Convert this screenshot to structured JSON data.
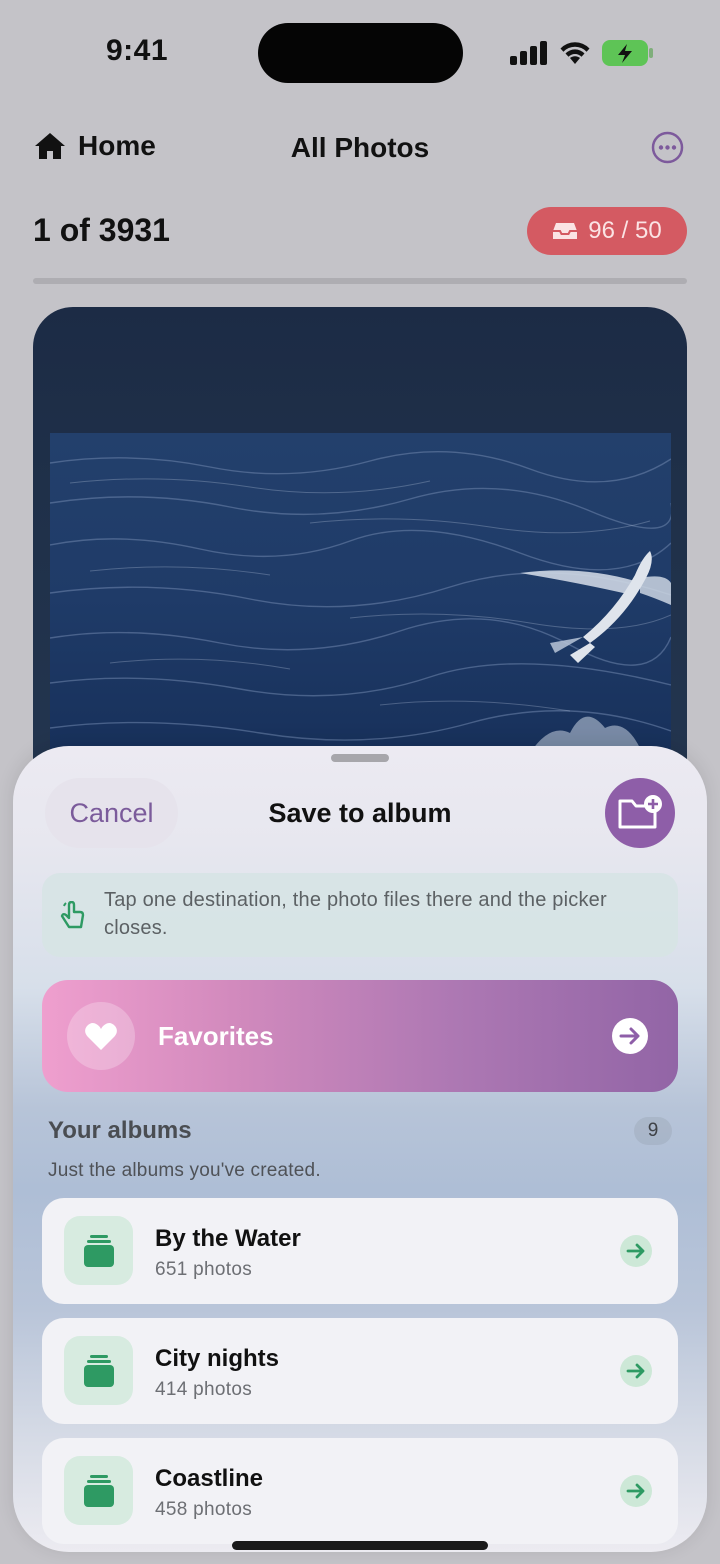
{
  "status_bar": {
    "time": "9:41",
    "icons": [
      "cellular-signal-icon",
      "wifi-icon",
      "battery-charging-icon"
    ],
    "battery_color": "#5ec456"
  },
  "nav": {
    "back_label": "Home",
    "back_icon": "house-icon",
    "title": "All Photos",
    "more_icon": "ellipsis-circle-icon"
  },
  "counter": {
    "text": "1 of 3931"
  },
  "quota_badge": {
    "icon": "tray-icon",
    "text": "96 / 50",
    "color": "#d45a62"
  },
  "photo": {
    "subject_icon": "photo-ocean-flying-fish"
  },
  "sheet": {
    "cancel_label": "Cancel",
    "title": "Save to album",
    "new_album_icon": "folder-plus-icon",
    "accent_color": "#8e5ea8",
    "hint": {
      "icon": "tap-hand-icon",
      "text": "Tap one destination, the photo files there and the picker closes."
    },
    "favorites": {
      "icon": "heart-icon",
      "label": "Favorites",
      "arrow_icon": "arrow-right-circle-icon"
    },
    "albums_section": {
      "title": "Your albums",
      "count": "9",
      "subtitle": "Just the albums you've created."
    },
    "albums": [
      {
        "name": "By the Water",
        "count": "651 photos",
        "icon": "album-stack-icon"
      },
      {
        "name": "City nights",
        "count": "414 photos",
        "icon": "album-stack-icon"
      },
      {
        "name": "Coastline",
        "count": "458 photos",
        "icon": "album-stack-icon"
      }
    ]
  }
}
